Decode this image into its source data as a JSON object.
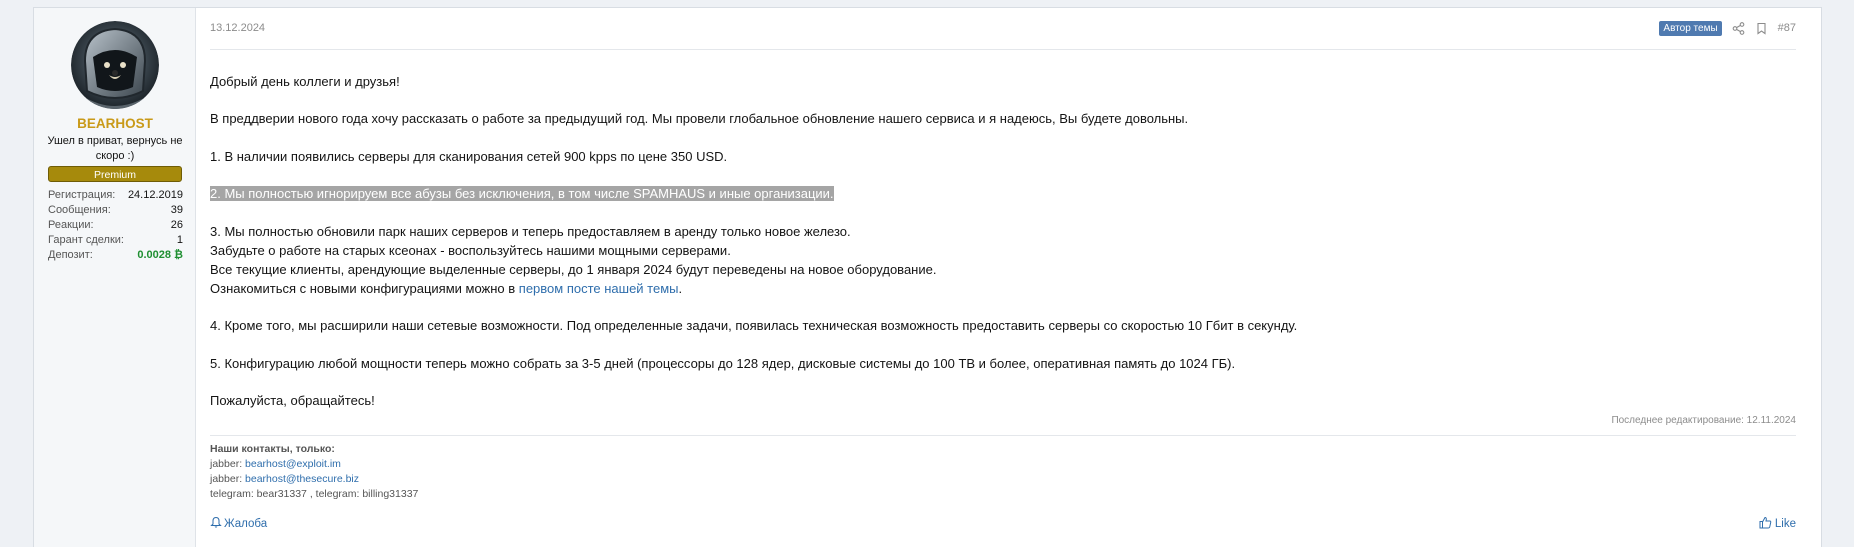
{
  "user": {
    "name": "BEARHOST",
    "title": "Ушел в приват, вернусь не скоро :)",
    "banner": "Premium",
    "avatar_icon": "astronaut-bear-avatar",
    "stats": [
      {
        "label": "Регистрация:",
        "value": "24.12.2019"
      },
      {
        "label": "Сообщения:",
        "value": "39"
      },
      {
        "label": "Реакции:",
        "value": "26"
      },
      {
        "label": "Гарант сделки:",
        "value": "1"
      },
      {
        "label": "Депозит:",
        "value": "0.0028 ₿"
      }
    ]
  },
  "post": {
    "date": "13.12.2024",
    "author_badge": "Автор темы",
    "number": "#87",
    "greeting": "Добрый день коллеги и друзья!",
    "intro": "В преддверии нового года хочу рассказать о работе за предыдущий год. Мы провели глобальное обновление нашего сервиса и я надеюсь, Вы будете довольны.",
    "item1": "1. В наличии появились серверы для сканирования сетей 900 kpps по цене 350 USD.",
    "item2": "2. Мы полностью игнорируем все абузы без исключения, в том числе SPAMHAUS и иные организации.",
    "item3_l1": "3. Мы полностью обновили парк наших серверов и теперь предоставляем в аренду только новое железо.",
    "item3_l2": "Забудьте о работе на старых ксеонах - воспользуйтесь нашими мощными серверами.",
    "item3_l3": "Все текущие клиенты, арендующие выделенные серверы, до 1 января 2024 будут переведены на новое оборудование.",
    "item3_l4_prefix": "Ознакомиться с новыми конфигурациями можно в ",
    "item3_l4_link": "первом посте нашей темы",
    "item3_l4_suffix": ".",
    "item4": "4. Кроме того, мы расширили наши сетевые возможности. Под определенные задачи, появилась техническая возможность предоставить серверы со скоростью 10 Гбит в секунду.",
    "item5": "5. Конфигурацию любой мощности теперь можно собрать за 3-5 дней (процессоры до 128 ядер, дисковые системы до 100 ТВ и более, оперативная память до 1024 ГБ).",
    "closing": "Пожалуйста, обращайтесь!",
    "last_edited": "Последнее редактирование: 12.11.2024"
  },
  "signature": {
    "title": "Наши контакты, только:",
    "jabber1_label": "jabber: ",
    "jabber1": "bearhost@exploit.im",
    "jabber2_label": "jabber: ",
    "jabber2": "bearhost@thesecure.biz",
    "telegram": "telegram: bear31337 , telegram: billing31337"
  },
  "actions": {
    "report": "Жалоба",
    "like": "Like"
  },
  "colors": {
    "username": "#c99a19",
    "banner": "#a68a0c",
    "link": "#2f6eac",
    "author_badge": "#4f7ab0",
    "deposit": "#1f8f32"
  }
}
